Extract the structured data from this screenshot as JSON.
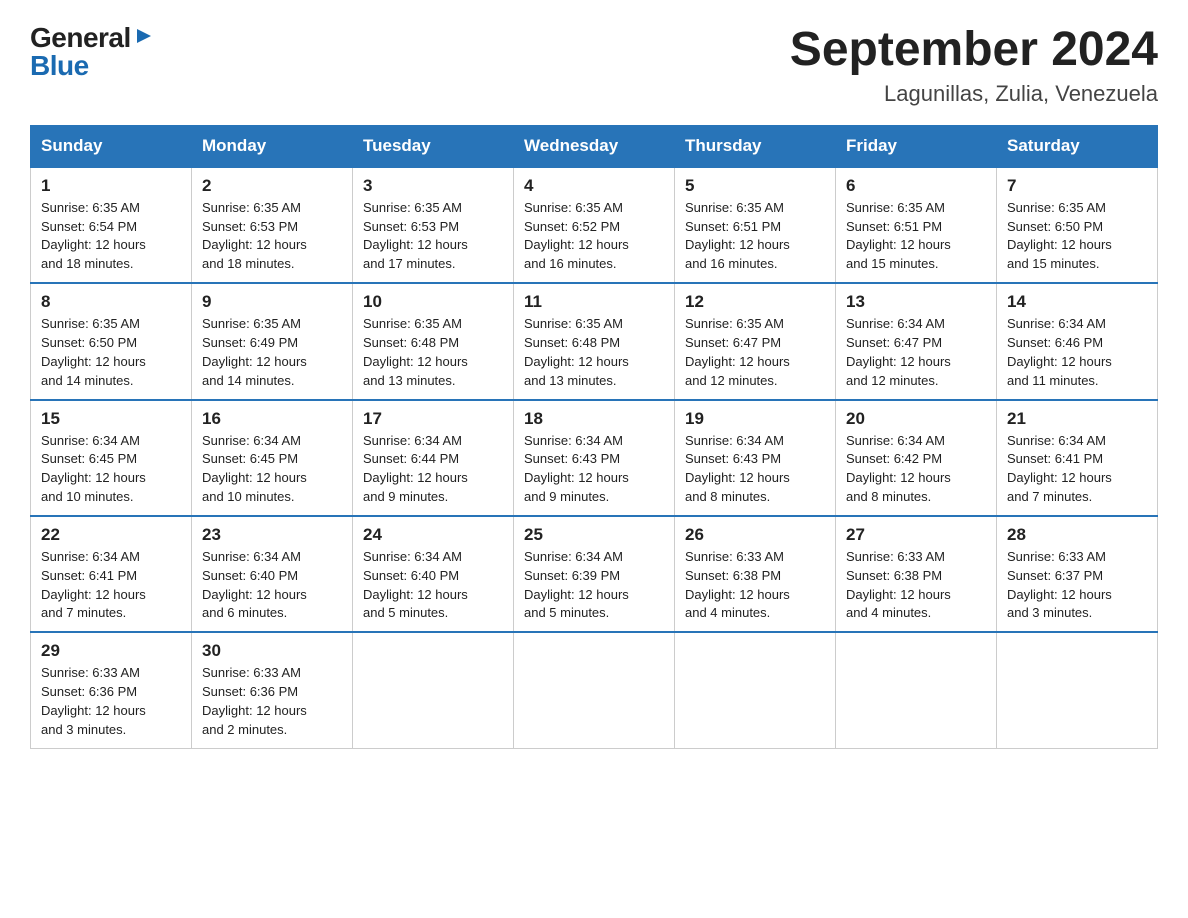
{
  "logo": {
    "general": "General",
    "blue": "Blue"
  },
  "header": {
    "month_year": "September 2024",
    "location": "Lagunillas, Zulia, Venezuela"
  },
  "weekdays": [
    "Sunday",
    "Monday",
    "Tuesday",
    "Wednesday",
    "Thursday",
    "Friday",
    "Saturday"
  ],
  "weeks": [
    [
      {
        "day": "1",
        "sunrise": "6:35 AM",
        "sunset": "6:54 PM",
        "daylight": "12 hours and 18 minutes."
      },
      {
        "day": "2",
        "sunrise": "6:35 AM",
        "sunset": "6:53 PM",
        "daylight": "12 hours and 18 minutes."
      },
      {
        "day": "3",
        "sunrise": "6:35 AM",
        "sunset": "6:53 PM",
        "daylight": "12 hours and 17 minutes."
      },
      {
        "day": "4",
        "sunrise": "6:35 AM",
        "sunset": "6:52 PM",
        "daylight": "12 hours and 16 minutes."
      },
      {
        "day": "5",
        "sunrise": "6:35 AM",
        "sunset": "6:51 PM",
        "daylight": "12 hours and 16 minutes."
      },
      {
        "day": "6",
        "sunrise": "6:35 AM",
        "sunset": "6:51 PM",
        "daylight": "12 hours and 15 minutes."
      },
      {
        "day": "7",
        "sunrise": "6:35 AM",
        "sunset": "6:50 PM",
        "daylight": "12 hours and 15 minutes."
      }
    ],
    [
      {
        "day": "8",
        "sunrise": "6:35 AM",
        "sunset": "6:50 PM",
        "daylight": "12 hours and 14 minutes."
      },
      {
        "day": "9",
        "sunrise": "6:35 AM",
        "sunset": "6:49 PM",
        "daylight": "12 hours and 14 minutes."
      },
      {
        "day": "10",
        "sunrise": "6:35 AM",
        "sunset": "6:48 PM",
        "daylight": "12 hours and 13 minutes."
      },
      {
        "day": "11",
        "sunrise": "6:35 AM",
        "sunset": "6:48 PM",
        "daylight": "12 hours and 13 minutes."
      },
      {
        "day": "12",
        "sunrise": "6:35 AM",
        "sunset": "6:47 PM",
        "daylight": "12 hours and 12 minutes."
      },
      {
        "day": "13",
        "sunrise": "6:34 AM",
        "sunset": "6:47 PM",
        "daylight": "12 hours and 12 minutes."
      },
      {
        "day": "14",
        "sunrise": "6:34 AM",
        "sunset": "6:46 PM",
        "daylight": "12 hours and 11 minutes."
      }
    ],
    [
      {
        "day": "15",
        "sunrise": "6:34 AM",
        "sunset": "6:45 PM",
        "daylight": "12 hours and 10 minutes."
      },
      {
        "day": "16",
        "sunrise": "6:34 AM",
        "sunset": "6:45 PM",
        "daylight": "12 hours and 10 minutes."
      },
      {
        "day": "17",
        "sunrise": "6:34 AM",
        "sunset": "6:44 PM",
        "daylight": "12 hours and 9 minutes."
      },
      {
        "day": "18",
        "sunrise": "6:34 AM",
        "sunset": "6:43 PM",
        "daylight": "12 hours and 9 minutes."
      },
      {
        "day": "19",
        "sunrise": "6:34 AM",
        "sunset": "6:43 PM",
        "daylight": "12 hours and 8 minutes."
      },
      {
        "day": "20",
        "sunrise": "6:34 AM",
        "sunset": "6:42 PM",
        "daylight": "12 hours and 8 minutes."
      },
      {
        "day": "21",
        "sunrise": "6:34 AM",
        "sunset": "6:41 PM",
        "daylight": "12 hours and 7 minutes."
      }
    ],
    [
      {
        "day": "22",
        "sunrise": "6:34 AM",
        "sunset": "6:41 PM",
        "daylight": "12 hours and 7 minutes."
      },
      {
        "day": "23",
        "sunrise": "6:34 AM",
        "sunset": "6:40 PM",
        "daylight": "12 hours and 6 minutes."
      },
      {
        "day": "24",
        "sunrise": "6:34 AM",
        "sunset": "6:40 PM",
        "daylight": "12 hours and 5 minutes."
      },
      {
        "day": "25",
        "sunrise": "6:34 AM",
        "sunset": "6:39 PM",
        "daylight": "12 hours and 5 minutes."
      },
      {
        "day": "26",
        "sunrise": "6:33 AM",
        "sunset": "6:38 PM",
        "daylight": "12 hours and 4 minutes."
      },
      {
        "day": "27",
        "sunrise": "6:33 AM",
        "sunset": "6:38 PM",
        "daylight": "12 hours and 4 minutes."
      },
      {
        "day": "28",
        "sunrise": "6:33 AM",
        "sunset": "6:37 PM",
        "daylight": "12 hours and 3 minutes."
      }
    ],
    [
      {
        "day": "29",
        "sunrise": "6:33 AM",
        "sunset": "6:36 PM",
        "daylight": "12 hours and 3 minutes."
      },
      {
        "day": "30",
        "sunrise": "6:33 AM",
        "sunset": "6:36 PM",
        "daylight": "12 hours and 2 minutes."
      },
      null,
      null,
      null,
      null,
      null
    ]
  ],
  "labels": {
    "sunrise": "Sunrise:",
    "sunset": "Sunset:",
    "daylight": "Daylight:"
  }
}
